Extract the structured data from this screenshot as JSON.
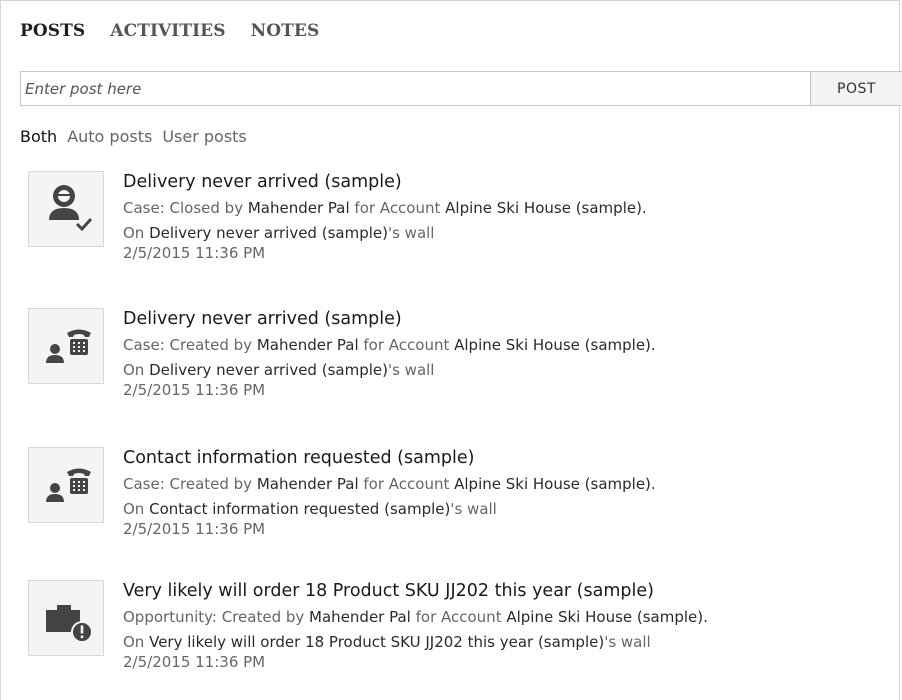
{
  "tabs": [
    {
      "label": "POSTS",
      "active": true
    },
    {
      "label": "ACTIVITIES",
      "active": false
    },
    {
      "label": "NOTES",
      "active": false
    }
  ],
  "post_box": {
    "placeholder": "Enter post here",
    "button_label": "POST"
  },
  "filters": [
    {
      "label": "Both",
      "active": true
    },
    {
      "label": "Auto posts",
      "active": false
    },
    {
      "label": "User posts",
      "active": false
    }
  ],
  "posts": [
    {
      "icon": "case-closed-icon",
      "title": "Delivery never arrived (sample)",
      "action_prefix": "Case: Closed by ",
      "actor": "Mahender Pal",
      "for_text": " for Account ",
      "account": "Alpine Ski House (sample).",
      "wall_prefix": "On ",
      "wall_record": "Delivery never arrived (sample)",
      "wall_suffix": "'s wall",
      "timestamp": "2/5/2015 11:36 PM"
    },
    {
      "icon": "case-phone-icon",
      "title": "Delivery never arrived (sample)",
      "action_prefix": "Case: Created by ",
      "actor": "Mahender Pal",
      "for_text": " for Account ",
      "account": "Alpine Ski House (sample).",
      "wall_prefix": "On ",
      "wall_record": "Delivery never arrived (sample)",
      "wall_suffix": "'s wall",
      "timestamp": "2/5/2015 11:36 PM"
    },
    {
      "icon": "case-phone-icon",
      "title": "Contact information requested (sample)",
      "action_prefix": "Case: Created by ",
      "actor": "Mahender Pal",
      "for_text": " for Account ",
      "account": "Alpine Ski House (sample).",
      "wall_prefix": "On ",
      "wall_record": "Contact information requested (sample)",
      "wall_suffix": "'s wall",
      "timestamp": "2/5/2015 11:36 PM"
    },
    {
      "icon": "opportunity-alert-icon",
      "title": "Very likely will order 18 Product SKU JJ202 this year (sample)",
      "action_prefix": "Opportunity: Created by ",
      "actor": "Mahender Pal",
      "for_text": " for Account ",
      "account": "Alpine Ski House (sample).",
      "wall_prefix": "On ",
      "wall_record": "Very likely will order 18 Product SKU JJ202 this year (sample)",
      "wall_suffix": "'s wall",
      "timestamp": "2/5/2015 11:36 PM"
    }
  ]
}
